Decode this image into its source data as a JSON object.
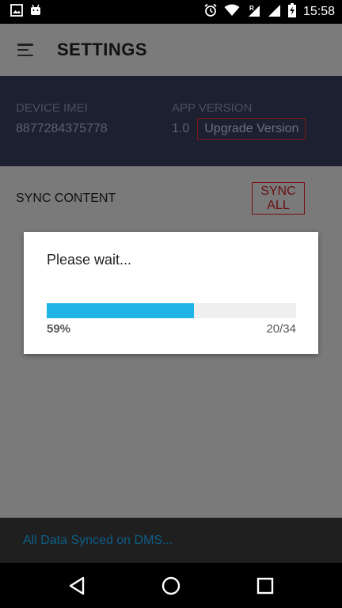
{
  "status_bar": {
    "time": "15:58",
    "left_icons": [
      "image-icon",
      "android-icon"
    ],
    "right_icons": [
      "alarm-icon",
      "wifi-icon",
      "signal-roaming-icon",
      "signal-icon",
      "battery-charging-icon"
    ]
  },
  "app_bar": {
    "title": "SETTINGS",
    "menu_icon": "menu-icon"
  },
  "device_info": {
    "imei_label": "DEVICE IMEI",
    "imei_value": "8877284375778",
    "version_label": "APP VERSION",
    "version_value": "1.0",
    "upgrade_label": "Upgrade Version"
  },
  "sync": {
    "label": "SYNC CONTENT",
    "button_label": "SYNC ALL"
  },
  "dialog": {
    "message": "Please wait...",
    "progress_percent": 59,
    "progress_text": "59%",
    "count_text": "20/34"
  },
  "bottom_bar": {
    "message": "All Data Synced on DMS..."
  },
  "nav_bar": {
    "icons": [
      "back-icon",
      "home-icon",
      "recents-icon"
    ]
  },
  "colors": {
    "accent": "#1eb5e6",
    "panel": "#1d2030",
    "sync_text": "#0f5d86"
  }
}
